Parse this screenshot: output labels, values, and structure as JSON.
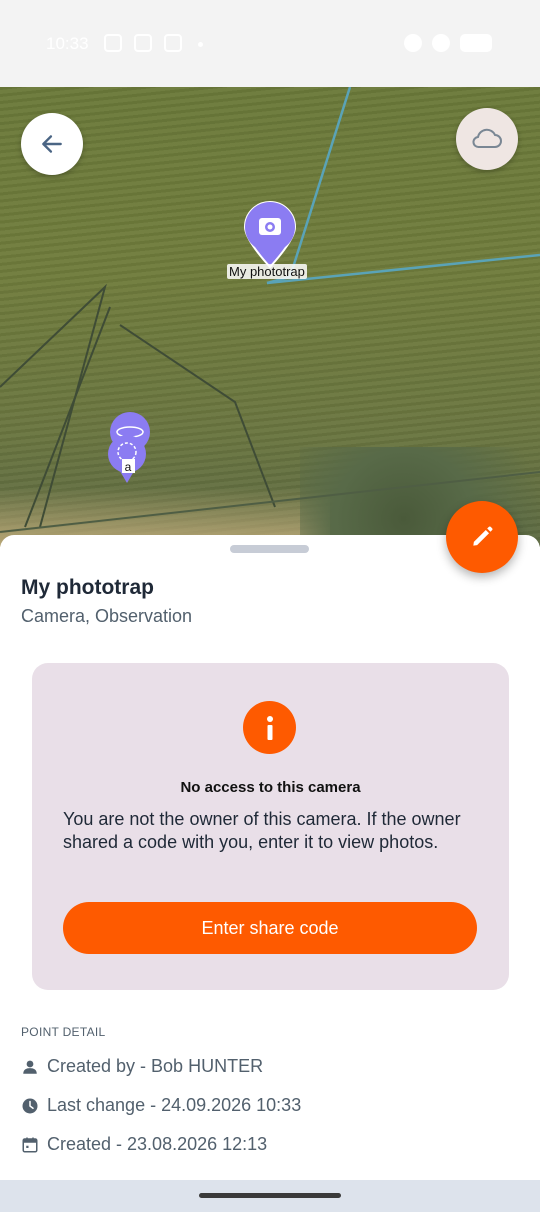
{
  "status_bar": {
    "time": "10:33"
  },
  "map": {
    "marker_label": "My phototrap",
    "secondary_marker_label": "a"
  },
  "sheet": {
    "title": "My phototrap",
    "subtitle": "Camera, Observation"
  },
  "access_card": {
    "heading": "No access to this camera",
    "body": "You are not the owner of this camera. If the owner shared a code with you, enter it to view photos.",
    "button_label": "Enter share code"
  },
  "point_detail": {
    "section_label": "POINT DETAIL",
    "created_by": "Created by - Bob HUNTER",
    "last_change": "Last change - 24.09.2026 10:33",
    "created": "Created - 23.08.2026 12:13"
  },
  "colors": {
    "accent": "#fe5a00",
    "marker": "#8b7cf2",
    "card_background": "#e9dfe8"
  },
  "icons": {
    "back": "arrow-left-icon",
    "cloud": "cloud-icon",
    "edit": "pencil-icon",
    "info": "info-icon",
    "person": "person-icon",
    "clock": "clock-icon",
    "calendar": "calendar-icon"
  }
}
